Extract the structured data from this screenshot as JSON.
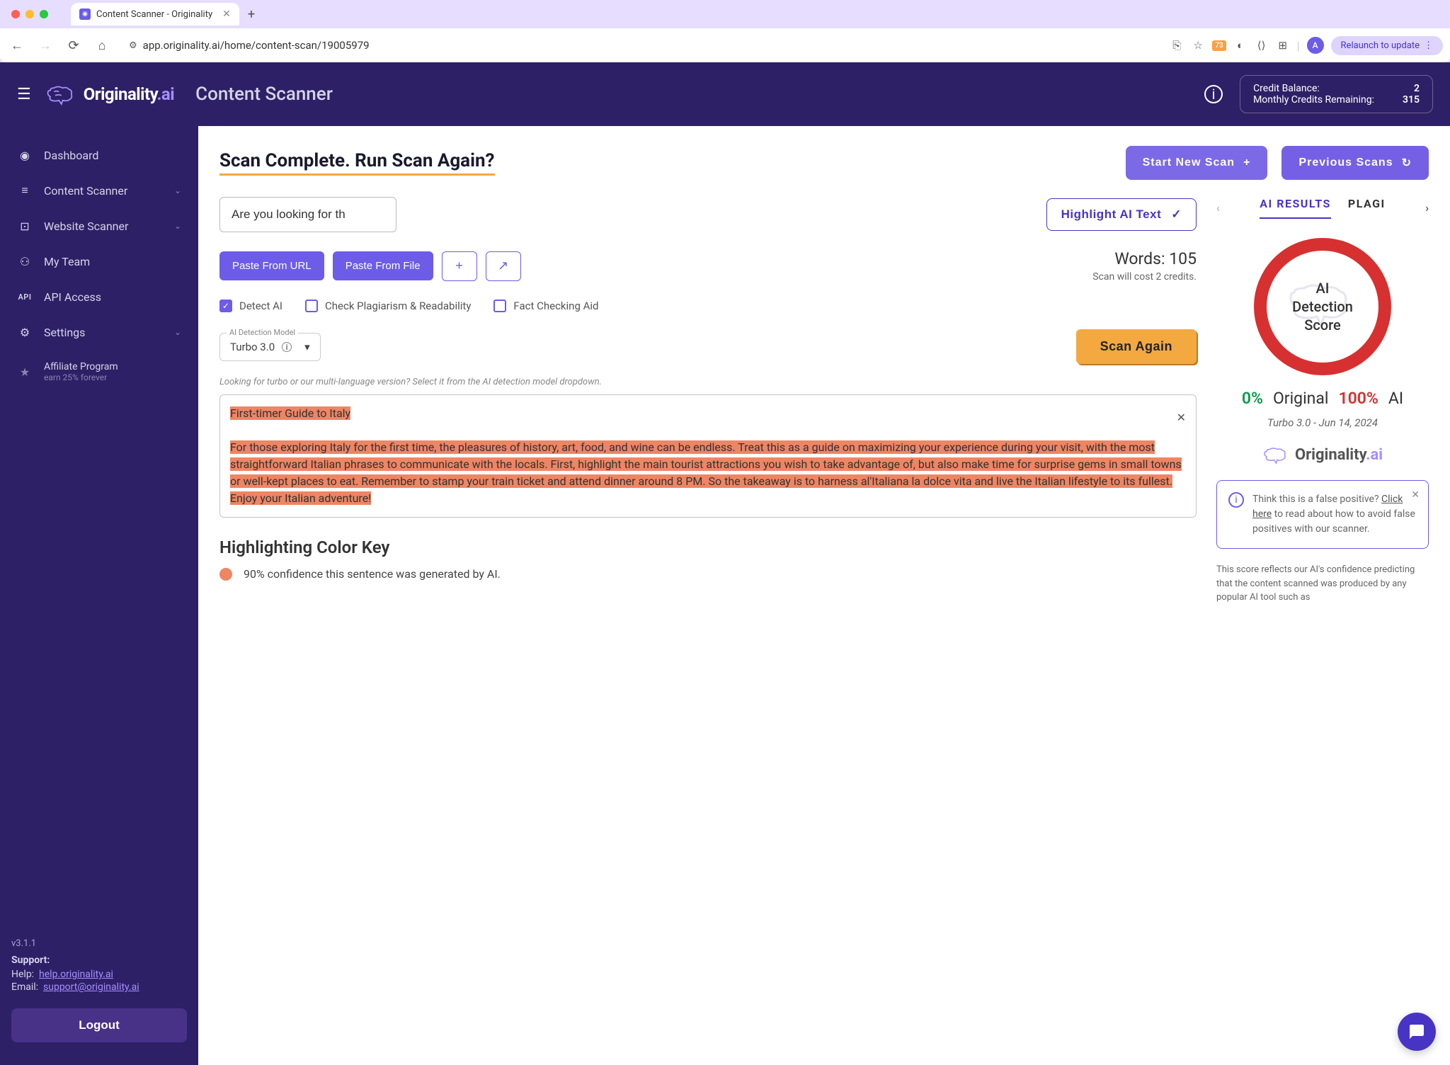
{
  "browser": {
    "tab_title": "Content Scanner - Originality",
    "url": "app.originality.ai/home/content-scan/19005979",
    "avatar": "A",
    "relaunch": "Relaunch to update",
    "ext_badge": "73"
  },
  "header": {
    "brand": "Originality",
    "brand_suffix": ".ai",
    "page": "Content Scanner",
    "credit_bal_label": "Credit Balance:",
    "credit_bal_val": "2",
    "monthly_label": "Monthly Credits Remaining:",
    "monthly_val": "315"
  },
  "sidebar": {
    "items": [
      {
        "label": "Dashboard"
      },
      {
        "label": "Content Scanner"
      },
      {
        "label": "Website Scanner"
      },
      {
        "label": "My Team"
      },
      {
        "label": "API Access"
      },
      {
        "label": "Settings"
      }
    ],
    "affiliate": {
      "name": "Affiliate Program",
      "sub": "earn 25% forever"
    },
    "version": "v3.1.1",
    "support_label": "Support:",
    "help_label": "Help:",
    "help_link": "help.originality.ai",
    "email_label": "Email:",
    "email_link": "support@originality.ai",
    "logout": "Logout"
  },
  "main": {
    "headline": "Scan Complete. Run Scan Again?",
    "start_new": "Start New Scan",
    "previous": "Previous Scans",
    "title_value": "Are you looking for th",
    "highlight_ai": "Highlight AI Text",
    "paste_url": "Paste From URL",
    "paste_file": "Paste From File",
    "words_label": "Words: 105",
    "cost_label": "Scan will cost 2 credits.",
    "detect": "Detect AI",
    "plag": "Check Plagiarism & Readability",
    "fact": "Fact Checking Aid",
    "model_label": "AI Detection Model",
    "model_value": "Turbo 3.0",
    "scan_again": "Scan Again",
    "hint": "Looking for turbo or our multi-language version? Select it from the AI detection model dropdown.",
    "doc_title": "First-timer Guide to Italy",
    "doc_body": "For those exploring Italy for the first time, the pleasures of history, art, food, and wine can be endless. Treat this as a guide on maximizing your experience during your visit, with the most straightforward Italian phrases to communicate with the locals. First, highlight the main tourist attractions you wish to take advantage of, but also make time for surprise gems in small towns or well-kept places to eat. Remember to stamp your train ticket and attend dinner around 8 PM. So the takeaway is to harness al'Italiana la dolce vita and live the Italian lifestyle to its fullest. Enjoy your Italian adventure!",
    "key_heading": "Highlighting Color Key",
    "key_90": "90% confidence this sentence was generated by AI."
  },
  "results": {
    "tab_ai": "AI RESULTS",
    "tab_plag": "PLAGI",
    "score_label_1": "AI Detection",
    "score_label_2": "Score",
    "original_pct": "0%",
    "original_lbl": "Original",
    "ai_pct": "100%",
    "ai_lbl": "AI",
    "model_date": "Turbo 3.0 - Jun 14, 2024",
    "brand": "Originality",
    "brand_suffix": ".ai",
    "info_pre": "Think this is a false positive? ",
    "info_link": "Click here",
    "info_post": " to read about how to avoid false positives with our scanner.",
    "disclaimer": "This score reflects our AI's confidence predicting that the content scanned was produced by any popular AI tool such as"
  }
}
